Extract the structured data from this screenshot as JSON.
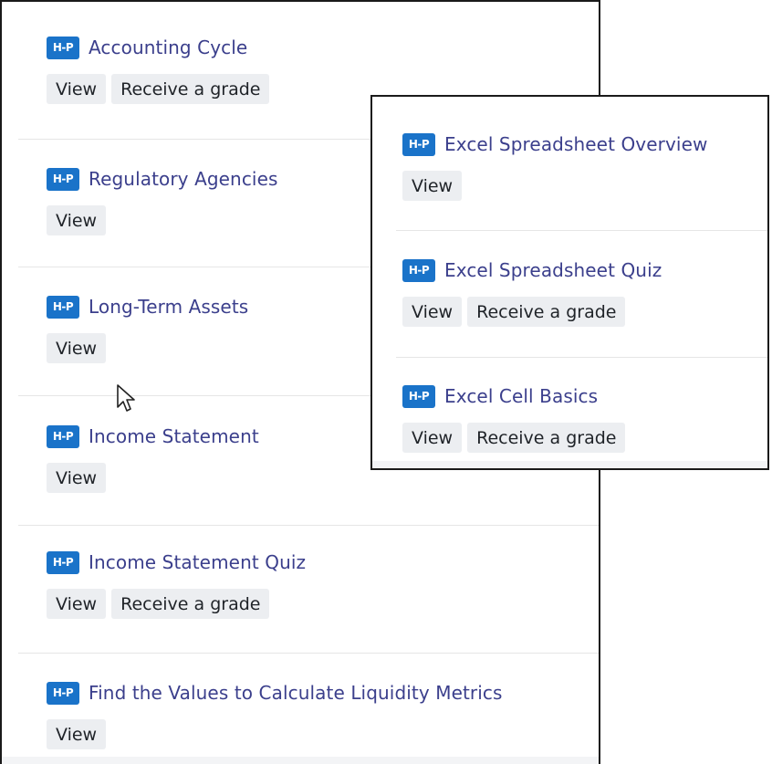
{
  "icon_text": "H-P",
  "left_panel": {
    "activities": [
      {
        "title": "Accounting Cycle",
        "view": "View",
        "grade": "Receive a grade"
      },
      {
        "title": "Regulatory Agencies",
        "view": "View"
      },
      {
        "title": "Long-Term Assets",
        "view": "View"
      },
      {
        "title": "Income Statement",
        "view": "View"
      },
      {
        "title": "Income Statement Quiz",
        "view": "View",
        "grade": "Receive a grade"
      },
      {
        "title": "Find the Values to Calculate Liquidity Metrics",
        "view": "View"
      }
    ]
  },
  "right_panel": {
    "activities": [
      {
        "title": "Excel Spreadsheet Overview",
        "view": "View"
      },
      {
        "title": "Excel Spreadsheet Quiz",
        "view": "View",
        "grade": "Receive a grade"
      },
      {
        "title": "Excel Cell Basics",
        "view": "View",
        "grade": "Receive a grade"
      }
    ]
  },
  "colors": {
    "icon_bg": "#1a73c9",
    "link": "#3b3f8c",
    "badge_bg": "#eceef1",
    "border": "#1a1a1a"
  },
  "icons": [
    "h5p-icon",
    "mouse-pointer-icon"
  ]
}
